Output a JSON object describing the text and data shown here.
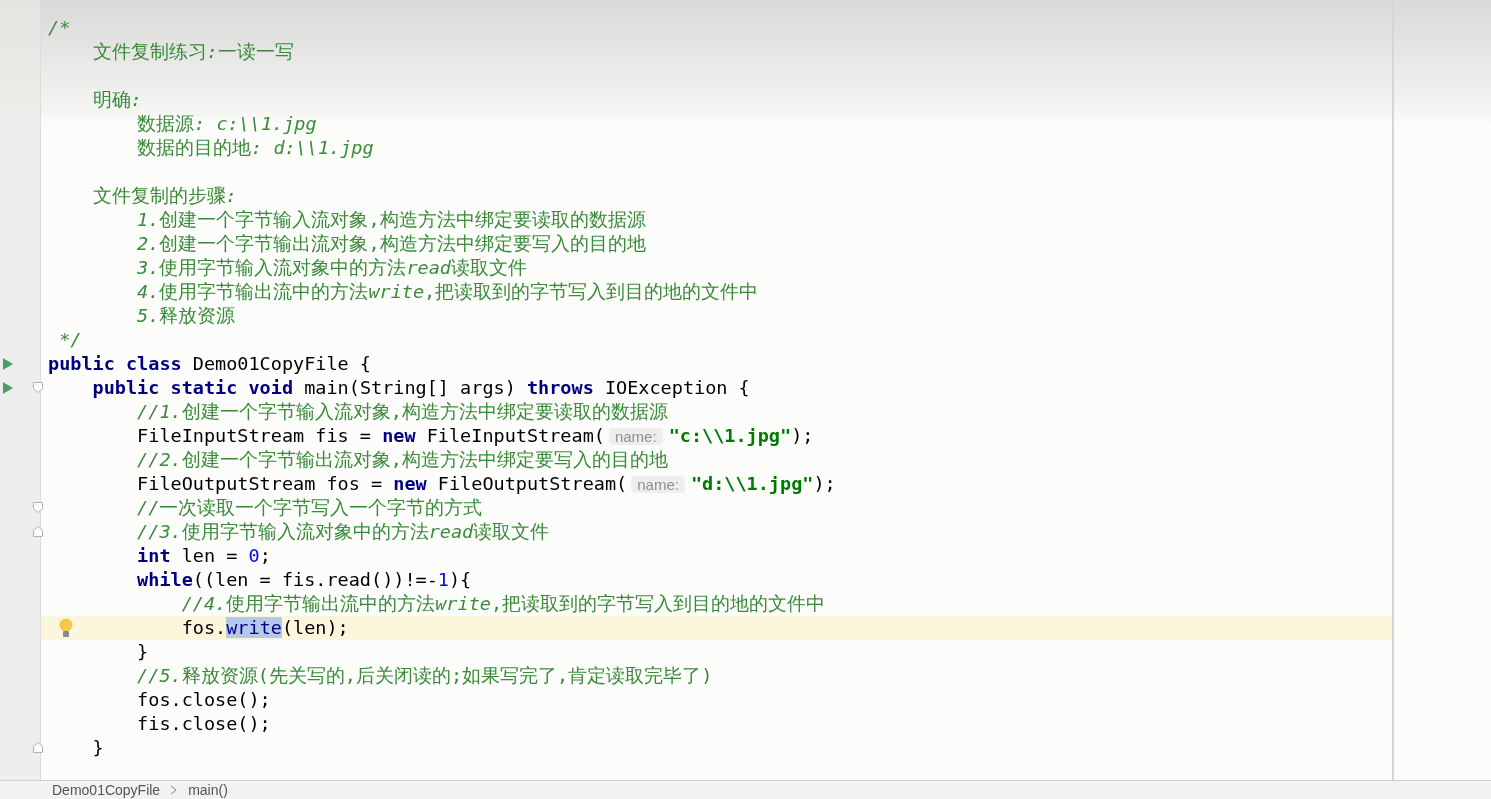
{
  "editor": {
    "lines": [
      {
        "current": false,
        "segments": [
          {
            "kind": "comment-italic",
            "text": "/*"
          }
        ]
      },
      {
        "current": false,
        "segments": [
          {
            "kind": "comment",
            "text": "    文件复制练习"
          },
          {
            "kind": "comment-italic",
            "text": ":"
          },
          {
            "kind": "comment",
            "text": "一读一写"
          }
        ]
      },
      {
        "current": false
      },
      {
        "current": false,
        "segments": [
          {
            "kind": "comment",
            "text": "    明确"
          },
          {
            "kind": "comment-italic",
            "text": ":"
          }
        ]
      },
      {
        "current": false,
        "segments": [
          {
            "kind": "comment",
            "text": "        数据源"
          },
          {
            "kind": "comment-italic",
            "text": ": c:\\\\1.jpg"
          }
        ]
      },
      {
        "current": false,
        "segments": [
          {
            "kind": "comment",
            "text": "        数据的目的地"
          },
          {
            "kind": "comment-italic",
            "text": ": d:\\\\1.jpg"
          }
        ]
      },
      {
        "current": false
      },
      {
        "current": false,
        "segments": [
          {
            "kind": "comment",
            "text": "    文件复制的步骤"
          },
          {
            "kind": "comment-italic",
            "text": ":"
          }
        ]
      },
      {
        "current": false,
        "segments": [
          {
            "kind": "comment-italic",
            "text": "        1."
          },
          {
            "kind": "comment",
            "text": "创建一个字节输入流对象,构造方法中绑定要读取的数据源"
          }
        ]
      },
      {
        "current": false,
        "segments": [
          {
            "kind": "comment-italic",
            "text": "        2."
          },
          {
            "kind": "comment",
            "text": "创建一个字节输出流对象,构造方法中绑定要写入的目的地"
          }
        ]
      },
      {
        "current": false,
        "segments": [
          {
            "kind": "comment-italic",
            "text": "        3."
          },
          {
            "kind": "comment",
            "text": "使用字节输入流对象中的方法"
          },
          {
            "kind": "comment-italic",
            "text": "read"
          },
          {
            "kind": "comment",
            "text": "读取文件"
          }
        ]
      },
      {
        "current": false,
        "segments": [
          {
            "kind": "comment-italic",
            "text": "        4."
          },
          {
            "kind": "comment",
            "text": "使用字节输出流中的方法"
          },
          {
            "kind": "comment-italic",
            "text": "write"
          },
          {
            "kind": "comment",
            "text": ",把读取到的字节写入到目的地的文件中"
          }
        ]
      },
      {
        "current": false,
        "segments": [
          {
            "kind": "comment-italic",
            "text": "        5."
          },
          {
            "kind": "comment",
            "text": "释放资源"
          }
        ]
      },
      {
        "current": false,
        "segments": [
          {
            "kind": "comment-italic",
            "text": " */"
          }
        ]
      },
      {
        "current": false,
        "markers": [
          {
            "kind": "run"
          }
        ],
        "segments": [
          {
            "kind": "keyword",
            "text": "public class "
          },
          {
            "kind": "plain",
            "text": "Demo01CopyFile {"
          }
        ]
      },
      {
        "current": false,
        "markers": [
          {
            "kind": "run"
          },
          {
            "kind": "fold"
          }
        ],
        "segments": [
          {
            "kind": "keyword",
            "text": "    public static void "
          },
          {
            "kind": "plain",
            "text": "main(String[] args) "
          },
          {
            "kind": "keyword",
            "text": "throws "
          },
          {
            "kind": "plain",
            "text": "IOException {"
          }
        ]
      },
      {
        "current": false,
        "segments": [
          {
            "kind": "comment-italic",
            "text": "        //1."
          },
          {
            "kind": "comment",
            "text": "创建一个字节输入流对象,构造方法中绑定要读取的数据源"
          }
        ]
      },
      {
        "current": false,
        "segments": [
          {
            "kind": "plain",
            "text": "        FileInputStream fis = "
          },
          {
            "kind": "keyword",
            "text": "new "
          },
          {
            "kind": "plain",
            "text": "FileInputStream("
          },
          {
            "kind": "hint",
            "text": "name:"
          },
          {
            "kind": "string",
            "text": "\"c:\\\\1.jpg\""
          },
          {
            "kind": "plain",
            "text": ");"
          }
        ]
      },
      {
        "current": false,
        "segments": [
          {
            "kind": "comment-italic",
            "text": "        //2."
          },
          {
            "kind": "comment",
            "text": "创建一个字节输出流对象,构造方法中绑定要写入的目的地"
          }
        ]
      },
      {
        "current": false,
        "segments": [
          {
            "kind": "plain",
            "text": "        FileOutputStream fos = "
          },
          {
            "kind": "keyword",
            "text": "new "
          },
          {
            "kind": "plain",
            "text": "FileOutputStream("
          },
          {
            "kind": "hint",
            "text": "name:"
          },
          {
            "kind": "string",
            "text": "\"d:\\\\1.jpg\""
          },
          {
            "kind": "plain",
            "text": ");"
          }
        ]
      },
      {
        "current": false,
        "markers": [
          {
            "kind": "fold"
          }
        ],
        "segments": [
          {
            "kind": "comment-italic",
            "text": "        //"
          },
          {
            "kind": "comment",
            "text": "一次读取一个字节写入一个字节的方式"
          }
        ]
      },
      {
        "current": false,
        "markers": [
          {
            "kind": "fold-end"
          }
        ],
        "segments": [
          {
            "kind": "comment-italic",
            "text": "        //3."
          },
          {
            "kind": "comment",
            "text": "使用字节输入流对象中的方法"
          },
          {
            "kind": "comment-italic",
            "text": "read"
          },
          {
            "kind": "comment",
            "text": "读取文件"
          }
        ]
      },
      {
        "current": false,
        "segments": [
          {
            "kind": "keyword",
            "text": "        int "
          },
          {
            "kind": "plain",
            "text": "len = "
          },
          {
            "kind": "number",
            "text": "0"
          },
          {
            "kind": "plain",
            "text": ";"
          }
        ]
      },
      {
        "current": false,
        "segments": [
          {
            "kind": "keyword",
            "text": "        while"
          },
          {
            "kind": "plain",
            "text": "((len = fis.read())!=-"
          },
          {
            "kind": "number",
            "text": "1"
          },
          {
            "kind": "plain",
            "text": "){"
          }
        ]
      },
      {
        "current": false,
        "segments": [
          {
            "kind": "comment-italic",
            "text": "            //4."
          },
          {
            "kind": "comment",
            "text": "使用字节输出流中的方法"
          },
          {
            "kind": "comment-italic",
            "text": "write"
          },
          {
            "kind": "comment",
            "text": ",把读取到的字节写入到目的地的文件中"
          }
        ]
      },
      {
        "current": true,
        "markers": [
          {
            "kind": "bulb"
          }
        ],
        "segments": [
          {
            "kind": "plain",
            "text": "            fos."
          },
          {
            "kind": "selection",
            "text": "write"
          },
          {
            "kind": "plain",
            "text": "(len);"
          }
        ]
      },
      {
        "current": false,
        "segments": [
          {
            "kind": "plain",
            "text": "        }"
          }
        ]
      },
      {
        "current": false,
        "segments": [
          {
            "kind": "comment-italic",
            "text": "        //5."
          },
          {
            "kind": "comment",
            "text": "释放资源(先关写的,后关闭读的;如果写完了,肯定读取完毕了)"
          }
        ]
      },
      {
        "current": false,
        "segments": [
          {
            "kind": "plain",
            "text": "        fos.close();"
          }
        ]
      },
      {
        "current": false,
        "segments": [
          {
            "kind": "plain",
            "text": "        fis.close();"
          }
        ]
      },
      {
        "current": false,
        "markers": [
          {
            "kind": "fold-end"
          }
        ],
        "segments": [
          {
            "kind": "plain",
            "text": "    }"
          }
        ]
      }
    ]
  },
  "breadcrumbs": [
    "Demo01CopyFile",
    "main()"
  ]
}
